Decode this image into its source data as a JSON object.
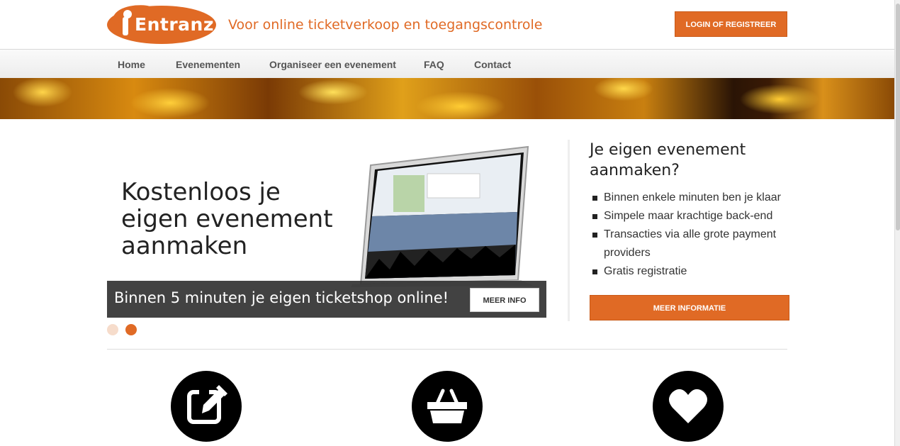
{
  "brand": {
    "logo_text": "Entranz",
    "tagline": "Voor online ticketverkoop en toegangscontrole",
    "accent_color": "#e06a25"
  },
  "header": {
    "login_label": "LOGIN OF REGISTREER"
  },
  "nav": {
    "items": [
      {
        "label": "Home"
      },
      {
        "label": "Evenementen"
      },
      {
        "label": "Organiseer een evenement"
      },
      {
        "label": "FAQ"
      },
      {
        "label": "Contact"
      }
    ]
  },
  "slider": {
    "title": "Kostenloos je eigen evenement aanmaken",
    "caption": "Binnen 5 minuten je eigen ticketshop online!",
    "button_label": "MEER INFO",
    "slide_count": 2,
    "active_slide": 2
  },
  "side_panel": {
    "title": "Je eigen evenement aanmaken?",
    "items": [
      "Binnen enkele minuten ben je klaar",
      "Simpele maar krachtige back-end",
      "Transacties via alle grote payment providers",
      "Gratis registratie"
    ],
    "button_label": "MEER INFORMATIE"
  },
  "features": {
    "icons": [
      "edit-icon",
      "basket-icon",
      "heart-icon"
    ]
  }
}
